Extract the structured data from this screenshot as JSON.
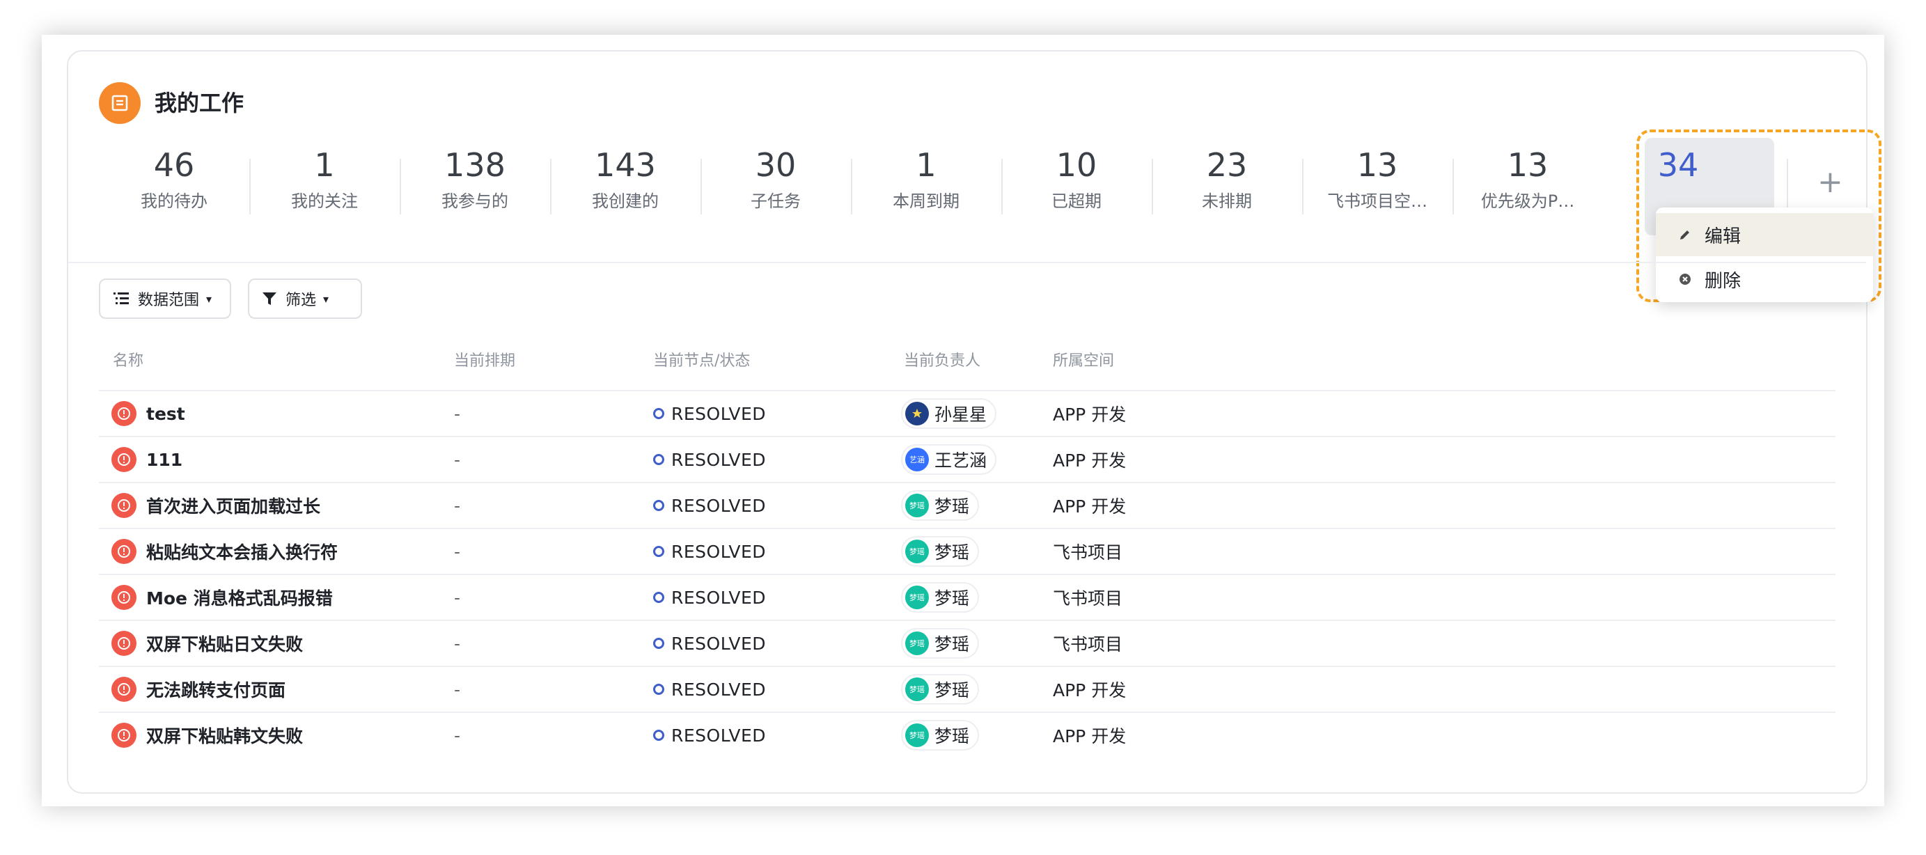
{
  "header": {
    "title": "我的工作",
    "icon": "list-icon"
  },
  "stats": [
    {
      "num": "46",
      "label": "我的待办"
    },
    {
      "num": "1",
      "label": "我的关注"
    },
    {
      "num": "138",
      "label": "我参与的"
    },
    {
      "num": "143",
      "label": "我创建的"
    },
    {
      "num": "30",
      "label": "子任务"
    },
    {
      "num": "1",
      "label": "本周到期"
    },
    {
      "num": "10",
      "label": "已超期"
    },
    {
      "num": "23",
      "label": "未排期"
    },
    {
      "num": "13",
      "label": "飞书项目空…"
    },
    {
      "num": "13",
      "label": "优先级为P…"
    },
    {
      "num": "34",
      "label": ""
    }
  ],
  "add_label": "+",
  "context_menu": {
    "edit": "编辑",
    "delete": "删除"
  },
  "toolbar": {
    "scope": "数据范围",
    "filter": "筛选"
  },
  "columns": {
    "name": "名称",
    "schedule": "当前排期",
    "status": "当前节点/状态",
    "owner": "当前负责人",
    "space": "所属空间"
  },
  "rows": [
    {
      "name": "test",
      "schedule": "-",
      "status": "RESOLVED",
      "owner": "孙星星",
      "space": "APP 开发"
    },
    {
      "name": "111",
      "schedule": "-",
      "status": "RESOLVED",
      "owner": "王艺涵",
      "space": "APP 开发"
    },
    {
      "name": "首次进入页面加载过长",
      "schedule": "-",
      "status": "RESOLVED",
      "owner": "梦瑶",
      "space": "APP 开发"
    },
    {
      "name": "粘贴纯文本会插入换行符",
      "schedule": "-",
      "status": "RESOLVED",
      "owner": "梦瑶",
      "space": "飞书项目"
    },
    {
      "name": "Moe 消息格式乱码报错",
      "schedule": "-",
      "status": "RESOLVED",
      "owner": "梦瑶",
      "space": "飞书项目"
    },
    {
      "name": "双屏下粘贴日文失败",
      "schedule": "-",
      "status": "RESOLVED",
      "owner": "梦瑶",
      "space": "飞书项目"
    },
    {
      "name": "无法跳转支付页面",
      "schedule": "-",
      "status": "RESOLVED",
      "owner": "梦瑶",
      "space": "APP 开发"
    },
    {
      "name": "双屏下粘贴韩文失败",
      "schedule": "-",
      "status": "RESOLVED",
      "owner": "梦瑶",
      "space": "APP 开发"
    }
  ],
  "avatars": {
    "孙星星": "#1f3f86",
    "王艺涵": "#3370ff",
    "梦瑶": "#14c0a2"
  },
  "avatar_texts": {
    "王艺涵": "艺涵",
    "梦瑶": "梦瑶"
  },
  "colors": {
    "accent": "#3f5ecc",
    "orange": "#f7892d",
    "bug": "#f0584a",
    "highlight": "#f5a623"
  }
}
